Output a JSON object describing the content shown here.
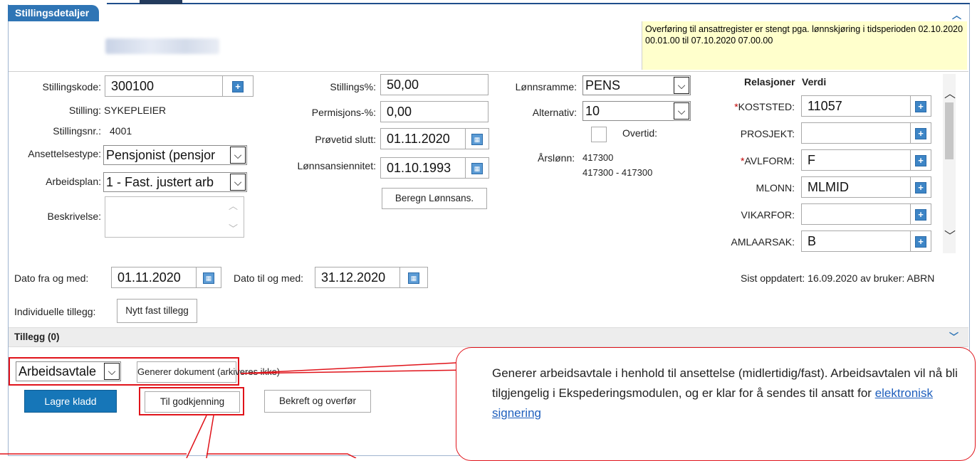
{
  "panel": {
    "tab_label": "Stillingsdetaljer",
    "notice": "Overføring til ansattregister er stengt pga. lønnskjøring i tidsperioden 02.10.2020 00.01.00 til 07.10.2020 07.00.00"
  },
  "col1": {
    "stillingskode_label": "Stillingskode:",
    "stillingskode_value": "300100",
    "stilling_label": "Stilling:",
    "stilling_value": "SYKEPLEIER",
    "stillingsnr_label": "Stillingsnr.:",
    "stillingsnr_value": "4001",
    "ansettelsestype_label": "Ansettelsestype:",
    "ansettelsestype_value": "Pensjonist (pensjor",
    "arbeidsplan_label": "Arbeidsplan:",
    "arbeidsplan_value": "1 - Fast. justert arb",
    "beskrivelse_label": "Beskrivelse:"
  },
  "col2": {
    "stillingsprosent_label": "Stillings%:",
    "stillingsprosent_value": "50,00",
    "permisjon_label": "Permisjons-%:",
    "permisjon_value": "0,00",
    "provetid_label": "Prøvetid slutt:",
    "provetid_value": "01.11.2020",
    "lonnsansiennitet_label": "Lønnsansiennitet:",
    "lonnsansiennitet_value": "01.10.1993",
    "beregn_button": "Beregn Lønnsans."
  },
  "col3": {
    "lonnsramme_label": "Lønnsramme:",
    "lonnsramme_value": "PENS",
    "alternativ_label": "Alternativ:",
    "alternativ_value": "10",
    "overtid_label": "Overtid:",
    "arslonn_label": "Årslønn:",
    "arslonn_value": "417300",
    "arslonn_range": "417300 - 417300"
  },
  "relations": {
    "header_relasjoner": "Relasjoner",
    "header_verdi": "Verdi",
    "rows": [
      {
        "label": "KOSTSTED:",
        "required_mark": "*",
        "value": "11057"
      },
      {
        "label": "PROSJEKT:",
        "required_mark": "",
        "value": ""
      },
      {
        "label": "AVLFORM:",
        "required_mark": "*",
        "value": "F"
      },
      {
        "label": "MLONN:",
        "required_mark": "",
        "value": "MLMID"
      },
      {
        "label": "VIKARFOR:",
        "required_mark": "",
        "value": ""
      },
      {
        "label": "AMLAARSAK:",
        "required_mark": "",
        "value": "B"
      }
    ]
  },
  "dates": {
    "fra_label": "Dato fra og med:",
    "fra_value": "01.11.2020",
    "til_label": "Dato til og med:",
    "til_value": "31.12.2020",
    "sist_oppdatert": "Sist oppdatert: 16.09.2020 av bruker: ABRN"
  },
  "tillegg": {
    "individuelle_label": "Individuelle tillegg:",
    "nytt_button": "Nytt fast tillegg",
    "section_title": "Tillegg (0)"
  },
  "actions": {
    "document_select": "Arbeidsavtale",
    "generer_button": "Generer dokument (arkiveres ikke)",
    "lagre_button": "Lagre kladd",
    "godkjenning_button": "Til godkjenning",
    "bekreft_button": "Bekreft og overfør"
  },
  "callout": {
    "text": "Generer arbeidsavtale i henhold til ansettelse (midlertidig/fast). Arbeidsavtalen vil nå bli tilgjengelig i Ekspederingsmodulen, og er klar for å sendes til ansatt for ",
    "link": "elektronisk signering"
  },
  "colors": {
    "tab_blue": "#2f75b5",
    "primary_button": "#1676b8",
    "annotation_red": "#e0131a",
    "notice_yellow": "#ffffcc"
  }
}
